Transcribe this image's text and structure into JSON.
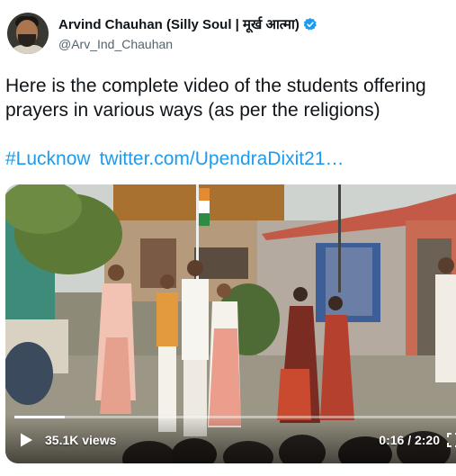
{
  "author": {
    "display_name": "Arvind Chauhan (Silly Soul | मूर्ख आत्मा)",
    "handle": "@Arv_Ind_Chauhan",
    "verified": true,
    "avatar_icon": "user-avatar"
  },
  "tweet": {
    "line1": "Here is the complete video of the students offering",
    "line2": "prayers in various ways (as per the religions)",
    "hashtag": "#Lucknow",
    "link": "twitter.com/UpendraDixit21…"
  },
  "video": {
    "views_label": "35.1K views",
    "time_label": "0:16 / 2:20",
    "progress": 0.114,
    "play_icon": "play-icon",
    "fullscreen_icon": "fullscreen-icon"
  },
  "colors": {
    "link": "#1d9bf0",
    "verified": "#1d9bf0",
    "handle": "#536471",
    "text": "#0f1419"
  }
}
